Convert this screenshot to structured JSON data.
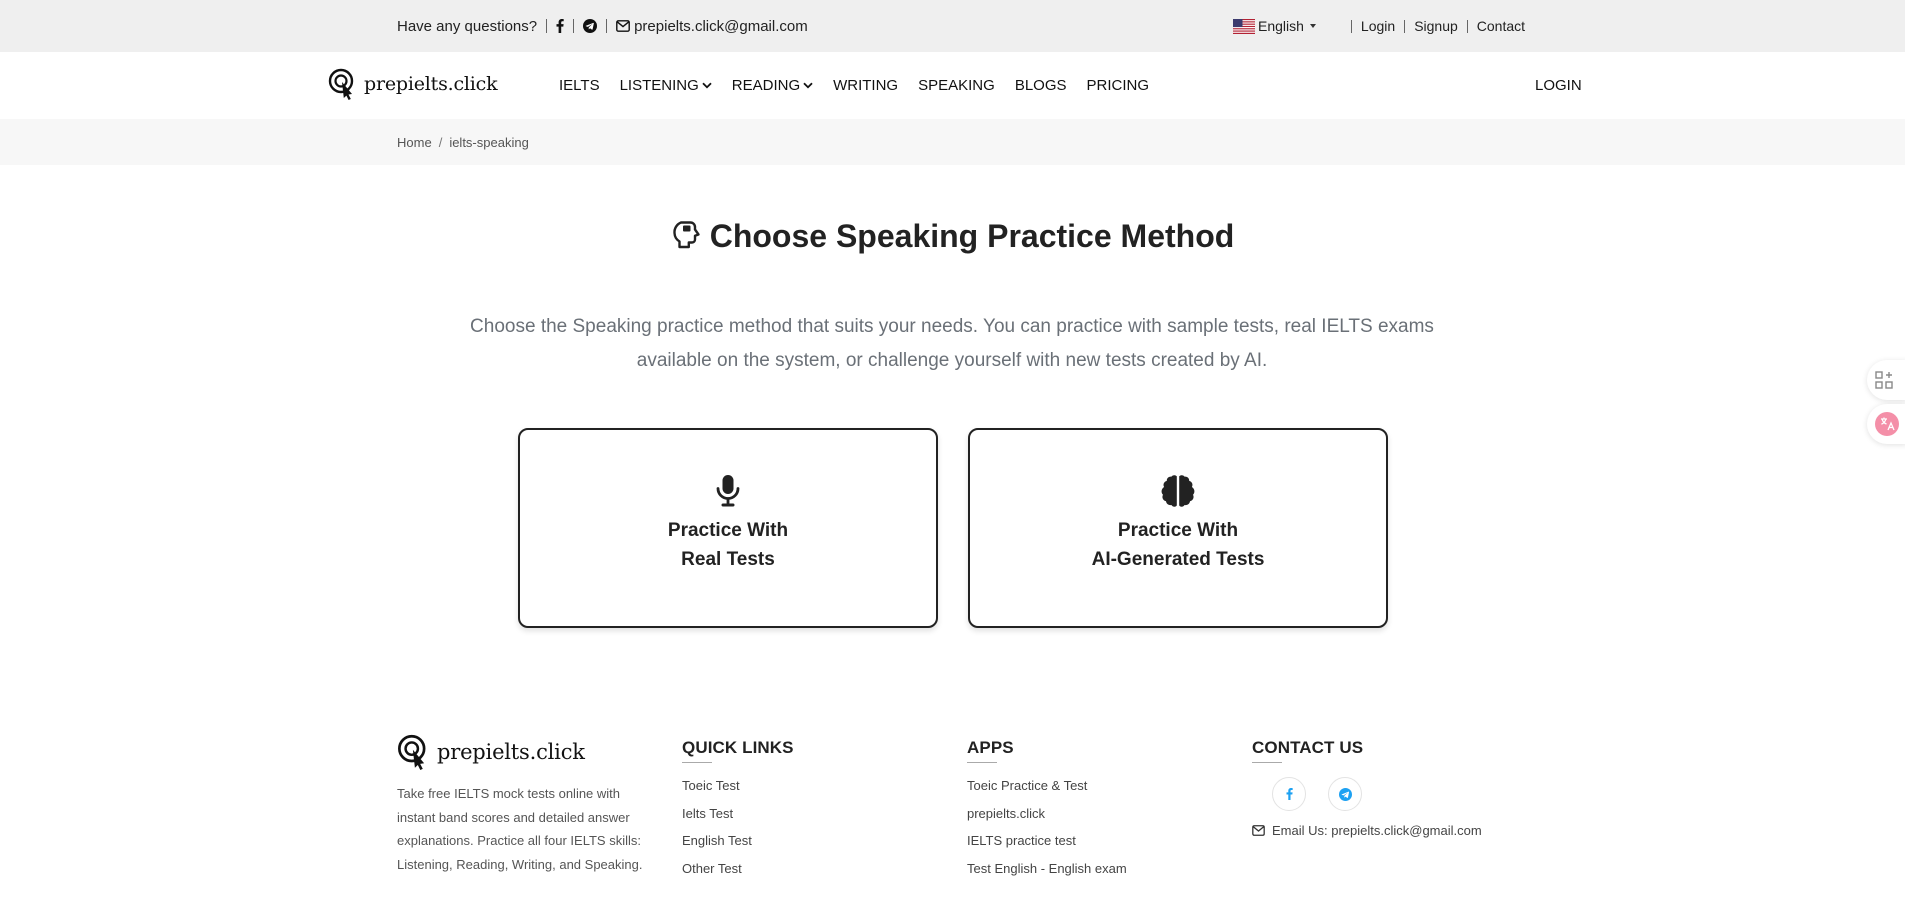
{
  "topbar": {
    "question": "Have any questions?",
    "email": "prepielts.click@gmail.com",
    "language": "English",
    "login": "Login",
    "signup": "Signup",
    "contact": "Contact",
    "icons": [
      "facebook-icon",
      "telegram-icon",
      "envelope-icon",
      "us-flag-icon"
    ]
  },
  "header": {
    "logo_text": "prepielts.click",
    "nav": [
      "IELTS",
      "LISTENING",
      "READING",
      "WRITING",
      "SPEAKING",
      "BLOGS",
      "PRICING"
    ],
    "login": "LOGIN"
  },
  "breadcrumb": {
    "home": "Home",
    "separator": "/",
    "current": "ielts-speaking"
  },
  "main": {
    "title": "Choose Speaking Practice Method",
    "intro": "Choose the Speaking practice method that suits your needs. You can practice with sample tests, real IELTS exams available on the system, or challenge yourself with new tests created by AI.",
    "cards": [
      {
        "line1": "Practice With",
        "line2": "Real Tests",
        "icon": "microphone-icon"
      },
      {
        "line1": "Practice With",
        "line2": "AI-Generated Tests",
        "icon": "brain-icon"
      }
    ]
  },
  "footer": {
    "logo_text": "prepielts.click",
    "description": "Take free IELTS mock tests online with instant band scores and detailed answer explanations. Practice all four IELTS skills: Listening, Reading, Writing, and Speaking.",
    "quick_links_title": "QUICK LINKS",
    "quick_links": [
      "Toeic Test",
      "Ielts Test",
      "English Test",
      "Other Test"
    ],
    "apps_title": "APPS",
    "apps": [
      "Toeic Practice & Test",
      "prepielts.click",
      "IELTS practice test",
      "Test English - English exam"
    ],
    "contact_title": "CONTACT US",
    "contact_email": "Email Us: prepielts.click@gmail.com"
  },
  "colors": {
    "topbar_bg": "#efefef",
    "breadcrumb_bg": "#f7f7f7",
    "intro_text": "#6a7077",
    "social_blue": "#1da1f2",
    "translate_pink": "#f48fa8"
  }
}
